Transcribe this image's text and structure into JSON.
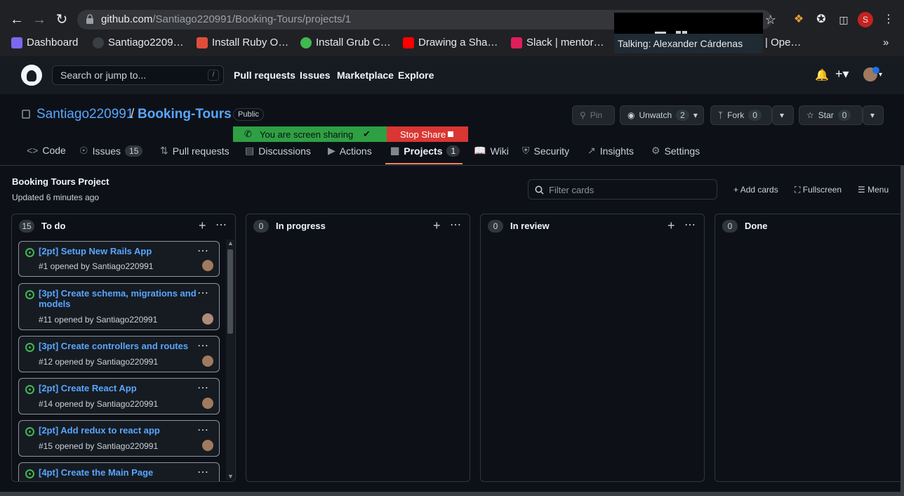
{
  "browser": {
    "url_domain": "github.com",
    "url_path": "/Santiago220991/Booking-Tours/projects/1",
    "bookmarks": [
      {
        "label": "Dashboard",
        "color": "#7b68ee"
      },
      {
        "label": "Santiago2209…",
        "color": "#24292f"
      },
      {
        "label": "Install Ruby O…",
        "color": "#e04e39"
      },
      {
        "label": "Install Grub C…",
        "color": "#3fb950"
      },
      {
        "label": "Drawing a Sha…",
        "color": "#ff0000"
      },
      {
        "label": "Slack | mentor…",
        "color": "#e01e5a"
      },
      {
        "label": "| Ope…",
        "color": "#202124"
      }
    ],
    "overlay_text": "Talking: Alexander Cárdenas"
  },
  "header": {
    "search_placeholder": "Search or jump to...",
    "search_key": "/",
    "nav": [
      "Pull requests",
      "Issues",
      "Marketplace",
      "Explore"
    ]
  },
  "repo": {
    "owner": "Santiago220991",
    "separator": "/",
    "name": "Booking-Tours",
    "visibility": "Public",
    "pin_label": "Pin",
    "unwatch_label": "Unwatch",
    "unwatch_count": "2",
    "fork_label": "Fork",
    "fork_count": "0",
    "star_label": "Star",
    "star_count": "0"
  },
  "screen_share": {
    "status": "You are screen sharing",
    "stop": "Stop Share"
  },
  "tabs": [
    {
      "label": "Code",
      "icon": "<>"
    },
    {
      "label": "Issues",
      "count": "15"
    },
    {
      "label": "Pull requests"
    },
    {
      "label": "Discussions"
    },
    {
      "label": "Actions"
    },
    {
      "label": "Projects",
      "count": "1"
    },
    {
      "label": "Wiki"
    },
    {
      "label": "Security"
    },
    {
      "label": "Insights"
    },
    {
      "label": "Settings"
    }
  ],
  "project": {
    "title": "Booking Tours Project",
    "updated": "Updated 6 minutes ago",
    "filter_placeholder": "Filter cards",
    "add_cards": "Add cards",
    "fullscreen": "Fullscreen",
    "menu": "Menu"
  },
  "columns": [
    {
      "name": "To do",
      "count": "15",
      "cards": [
        {
          "title": "[2pt] Setup New Rails App",
          "meta": "#1 opened by Santiago220991"
        },
        {
          "title": "[3pt] Create schema, migrations and models",
          "meta": "#11 opened by Santiago220991"
        },
        {
          "title": "[3pt] Create controllers and routes",
          "meta": "#12 opened by Santiago220991"
        },
        {
          "title": "[2pt] Create React App",
          "meta": "#14 opened by Santiago220991"
        },
        {
          "title": "[2pt] Add redux to react app",
          "meta": "#15 opened by Santiago220991"
        },
        {
          "title": "[4pt] Create the Main Page",
          "meta": ""
        }
      ]
    },
    {
      "name": "In progress",
      "count": "0",
      "cards": []
    },
    {
      "name": "In review",
      "count": "0",
      "cards": []
    },
    {
      "name": "Done",
      "count": "0",
      "cards": []
    }
  ]
}
